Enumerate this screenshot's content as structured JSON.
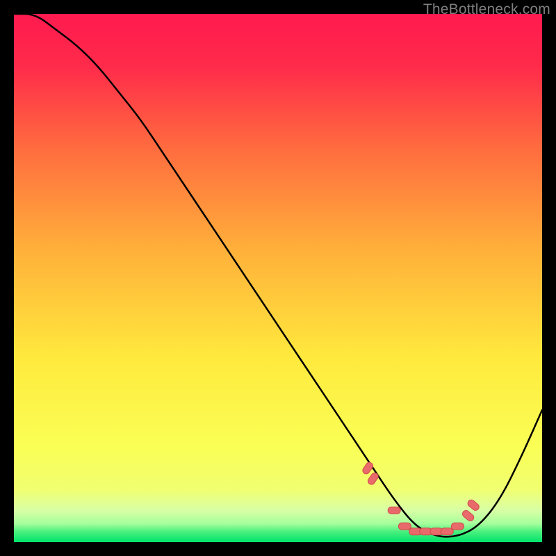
{
  "watermark": "TheBottleneck.com",
  "colors": {
    "top": "#ff1a4f",
    "mid": "#ffe93d",
    "green": "#00e36b",
    "pale": "#d8ffa6",
    "curve": "#000000",
    "marker_fill": "#e86a6a",
    "marker_stroke": "#d14a4a",
    "frame": "#000000"
  },
  "chart_data": {
    "type": "line",
    "title": "",
    "xlabel": "",
    "ylabel": "",
    "xlim": [
      0,
      100
    ],
    "ylim": [
      0,
      100
    ],
    "grid": false,
    "legend": false,
    "series": [
      {
        "name": "bottleneck-curve",
        "x": [
          0,
          4,
          8,
          12,
          16,
          20,
          24,
          28,
          32,
          36,
          40,
          44,
          48,
          52,
          56,
          60,
          64,
          68,
          72,
          76,
          80,
          84,
          88,
          92,
          96,
          100
        ],
        "values": [
          100,
          100,
          97,
          94,
          90,
          85,
          80,
          74,
          68,
          62,
          56,
          50,
          44,
          38,
          32,
          26,
          20,
          14,
          8,
          3,
          1,
          1,
          3,
          8,
          16,
          25
        ]
      }
    ],
    "markers": {
      "name": "highlight-points",
      "x": [
        67,
        68,
        72,
        74,
        76,
        78,
        80,
        82,
        84,
        86,
        87
      ],
      "values": [
        14,
        12,
        6,
        3,
        2,
        2,
        2,
        2,
        3,
        5,
        7
      ]
    }
  }
}
